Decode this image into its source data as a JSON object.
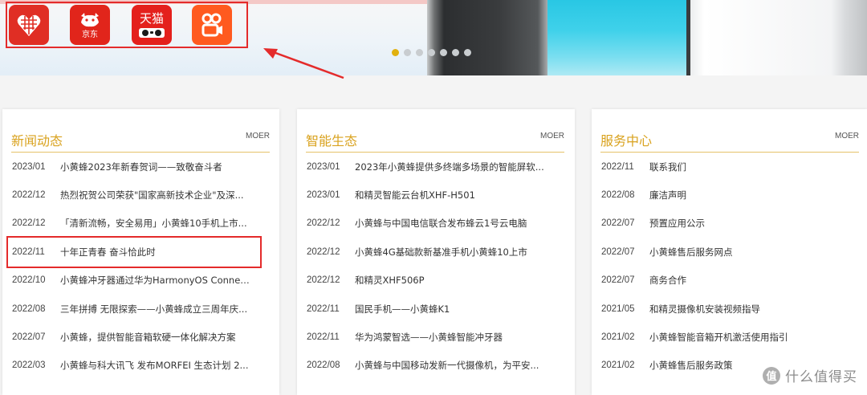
{
  "apps": [
    {
      "name": "pinduoduo",
      "label": ""
    },
    {
      "name": "jd",
      "label": "京东"
    },
    {
      "name": "tmall",
      "label": "天猫"
    },
    {
      "name": "kuaishou",
      "label": ""
    }
  ],
  "carousel": {
    "dot_count": 7,
    "active_index": 0
  },
  "colors": {
    "accent": "#d9a21e",
    "annotation": "#e42b2b",
    "active_dot": "#e1b10f"
  },
  "cards": [
    {
      "title": "新闻动态",
      "more": "MOER",
      "items": [
        {
          "date": "2023/01",
          "text": "小黄蜂2023年新春贺词——致敬奋斗者"
        },
        {
          "date": "2022/12",
          "text": "热烈祝贺公司荣获\"国家高新技术企业\"及深..."
        },
        {
          "date": "2022/12",
          "text": "「清新流畅，安全易用」小黄蜂10手机上市..."
        },
        {
          "date": "2022/11",
          "text": "十年正青春 奋斗恰此时"
        },
        {
          "date": "2022/10",
          "text": "小黄蜂冲牙器通过华为HarmonyOS Connect..."
        },
        {
          "date": "2022/08",
          "text": "三年拼搏 无限探索——小黄蜂成立三周年庆..."
        },
        {
          "date": "2022/07",
          "text": "小黄蜂，提供智能音箱软硬一体化解决方案"
        },
        {
          "date": "2022/03",
          "text": "小黄蜂与科大讯飞 发布MORFEI 生态计划 2..."
        }
      ]
    },
    {
      "title": "智能生态",
      "more": "MOER",
      "items": [
        {
          "date": "2023/01",
          "text": "2023年小黄蜂提供多终端多场景的智能屏软..."
        },
        {
          "date": "2023/01",
          "text": "和精灵智能云台机XHF-H501"
        },
        {
          "date": "2022/12",
          "text": "小黄蜂与中国电信联合发布蜂云1号云电脑"
        },
        {
          "date": "2022/12",
          "text": "小黄蜂4G基础款新基准手机小黄蜂10上市"
        },
        {
          "date": "2022/12",
          "text": "和精灵XHF506P"
        },
        {
          "date": "2022/11",
          "text": "国民手机——小黄蜂K1"
        },
        {
          "date": "2022/11",
          "text": "华为鸿蒙智选——小黄蜂智能冲牙器"
        },
        {
          "date": "2022/08",
          "text": "小黄蜂与中国移动发新一代摄像机，为平安..."
        }
      ]
    },
    {
      "title": "服务中心",
      "more": "MOER",
      "items": [
        {
          "date": "2022/11",
          "text": "联系我们"
        },
        {
          "date": "2022/08",
          "text": "廉洁声明"
        },
        {
          "date": "2022/07",
          "text": "预置应用公示"
        },
        {
          "date": "2022/07",
          "text": "小黄蜂售后服务网点"
        },
        {
          "date": "2022/07",
          "text": "商务合作"
        },
        {
          "date": "2021/05",
          "text": "和精灵摄像机安装视频指导"
        },
        {
          "date": "2021/02",
          "text": "小黄蜂智能音箱开机激活使用指引"
        },
        {
          "date": "2021/02",
          "text": "小黄蜂售后服务政策"
        }
      ]
    }
  ],
  "watermark": {
    "logo": "值",
    "text": "什么值得买"
  }
}
